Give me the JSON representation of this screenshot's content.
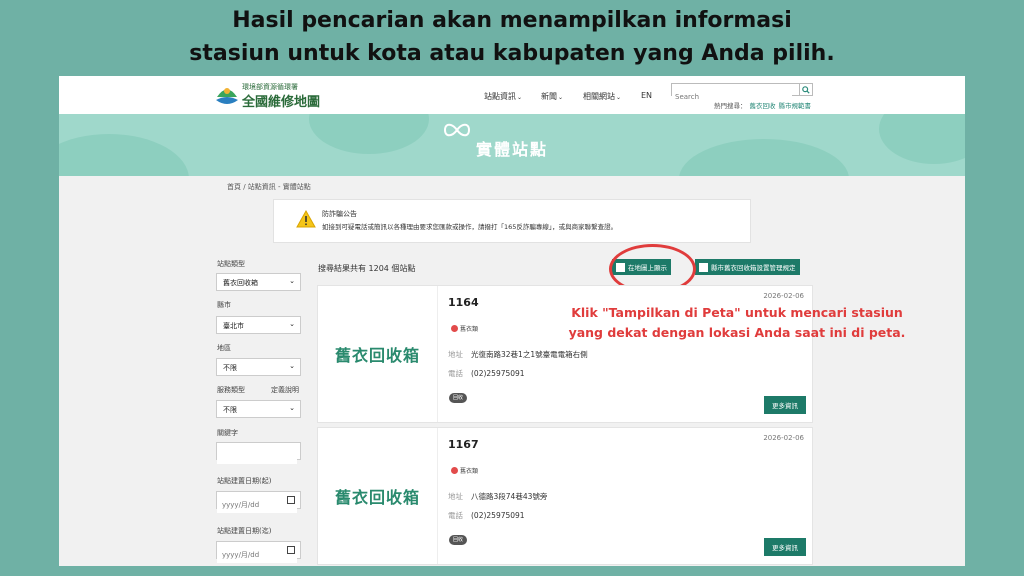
{
  "caption": {
    "line1": "Hasil pencarian akan menampilkan informasi",
    "line2": "stasiun untuk kota atau kabupaten yang Anda pilih."
  },
  "header": {
    "logo_sub": "環境部資源循環署",
    "logo_main": "全國維修地圖",
    "nav": [
      "站點資訊",
      "新聞",
      "相關網站",
      "EN"
    ],
    "search_placeholder": "Search",
    "hot_label": "熱門搜尋：",
    "hot_links": [
      "舊衣回收",
      "縣市規範書"
    ]
  },
  "banner": {
    "title": "實體站點"
  },
  "breadcrumb": "首頁 / 站點資訊 - 實體站點",
  "notice": {
    "title": "防詐騙公告",
    "body": "如接到可疑電話或簡訊以各種理由要求您匯款或操作，請撥打「165反詐騙專線」，或與商家聯繫查證。"
  },
  "sidebar": {
    "station_type_label": "站點類型",
    "station_type_value": "舊衣回收箱",
    "city_label": "縣市",
    "city_value": "臺北市",
    "district_label": "地區",
    "district_value": "不限",
    "service_label": "服務類型",
    "service_def_link": "定義說明",
    "service_value": "不限",
    "keyword_label": "關鍵字",
    "date_from_label": "站點建置日期(起)",
    "date_to_label": "站點建置日期(迄)",
    "date_placeholder": "yyyy/月/dd"
  },
  "results": {
    "count_text": "搜尋結果共有 1204 個站點",
    "map_button": "在地圖上顯示",
    "rules_button": "縣市舊衣回收箱設置管理規定"
  },
  "annotation": {
    "line1": "Klik \"Tampilkan di Peta\" untuk mencari stasiun",
    "line2": "yang dekat dengan lokasi Anda saat ini di peta."
  },
  "cards": [
    {
      "image_text": "舊衣回收箱",
      "id": "1164",
      "date": "2026-02-06",
      "tag": "舊衣類",
      "address_label": "地址",
      "address": "光復南路32巷1之1號臺電電箱右側",
      "phone_label": "電話",
      "phone": "(02)25975091",
      "badge": "回收",
      "more": "更多資訊"
    },
    {
      "image_text": "舊衣回收箱",
      "id": "1167",
      "date": "2026-02-06",
      "tag": "舊衣類",
      "address_label": "地址",
      "address": "八德路3段74巷43號旁",
      "phone_label": "電話",
      "phone": "(02)25975091",
      "badge": "回收",
      "more": "更多資訊"
    }
  ],
  "colors": {
    "accent": "#1d7a68",
    "annotation": "#e03c3c",
    "page_bg": "#6fb1a5",
    "banner": "#9fd8cb"
  }
}
